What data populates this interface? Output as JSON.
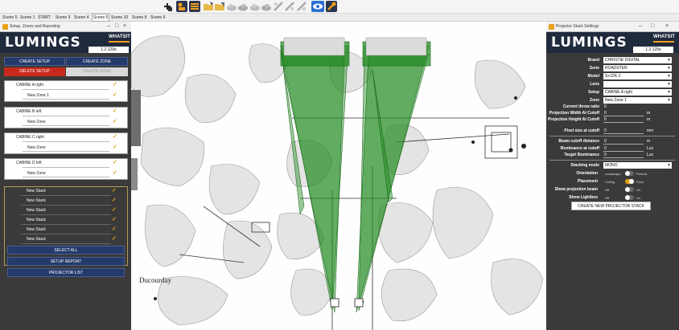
{
  "toolbar": {
    "icons": [
      "add-projector-icon",
      "layers-icon",
      "list-icon",
      "folder-open-icon",
      "folder-icon",
      "cloud-icon",
      "cloud-icon",
      "cloud-icon",
      "cloud-icon",
      "pencil-icon",
      "pencil-icon",
      "pencil-icon",
      "eye-icon",
      "wrench-icon"
    ],
    "active_icon_color": "#2a6fd3"
  },
  "scenes": [
    "Scene 5",
    "Scene 1",
    "START",
    "Scene 3",
    "Scene 4",
    "Scene 6",
    "Scene 10",
    "Scene 8",
    "Scene 9"
  ],
  "active_scene": "Scene 6",
  "left_panel": {
    "title": "Setup, Zones and Reporting",
    "logo": "LUMINGS",
    "brand": "WHATSIT",
    "version": "1.2.129e",
    "create_setup": "CREATE SETUP",
    "create_zone": "CREATE ZONE",
    "delete_setup": "DELETE SETUP",
    "delete_zone": "DELETE ZONE",
    "zones": [
      {
        "setup": "CABINE A right",
        "zone": "New Zone 1"
      },
      {
        "setup": "CABINE B left",
        "zone": "New Zone"
      },
      {
        "setup": "CABINE C right",
        "zone": "New Zone"
      },
      {
        "setup": "CABINE D left",
        "zone": "New Zone"
      }
    ],
    "stacks": [
      "New Stack",
      "New Stack",
      "New Stack",
      "New Stack",
      "New Stack",
      "New Stack"
    ],
    "select_all": "SELECT ALL",
    "setup_report": "SETUP REPORT",
    "projector_list": "PROJECTOR LIST"
  },
  "viewport": {
    "map_label": "Ducourday",
    "beam_color": "#1f8a1f"
  },
  "right_panel": {
    "title": "Projector Stack Settings",
    "logo": "LUMINGS",
    "brand": "WHATSIT",
    "version": "1.2.129e",
    "fields": {
      "brand": {
        "label": "Brand",
        "value": "CHRISTIE DIGITAL"
      },
      "serie": {
        "label": "Serie",
        "value": "ROADSTER"
      },
      "model": {
        "label": "Model",
        "value": "S+22K-J"
      },
      "lens": {
        "label": "Lens",
        "value": ""
      },
      "setup": {
        "label": "Setup",
        "value": "CABINE A right"
      },
      "zone": {
        "label": "Zone",
        "value": "New Zone 1"
      }
    },
    "metrics": {
      "throw_ratio": {
        "label": "Current throw ratio",
        "value": "0",
        "unit": ""
      },
      "proj_width": {
        "label": "Projection Width At Cutoff",
        "value": "0",
        "unit": "m"
      },
      "proj_height": {
        "label": "Projection Height At Cutoff",
        "value": "0",
        "unit": "m"
      },
      "pixel_size": {
        "label": "Pixel size at cutoff",
        "value": "0",
        "unit": "mm"
      },
      "beam_cutoff": {
        "label": "Beam cutoff distance",
        "value": "0",
        "unit": "m"
      },
      "illum_cutoff": {
        "label": "Illuminance at cutoff",
        "value": "0",
        "unit": "Lux"
      },
      "target_illum": {
        "label": "Target Illuminance",
        "value": "0",
        "unit": "Lux"
      }
    },
    "stacking": {
      "label": "Stacking mode",
      "value": "MONO"
    },
    "toggles": {
      "orientation": {
        "label": "Orientation",
        "off": "Landscape",
        "on": "Portrait"
      },
      "placement": {
        "label": "Placement",
        "off": "Ceiling",
        "on": "Floor"
      },
      "show_beam": {
        "label": "Show projection beam",
        "off": "Off",
        "on": "On"
      },
      "show_lightbox": {
        "label": "Show Lightbox",
        "off": "Off",
        "on": "On"
      }
    },
    "create_stack": "CREATE NEW PROJECTOR STACK"
  }
}
